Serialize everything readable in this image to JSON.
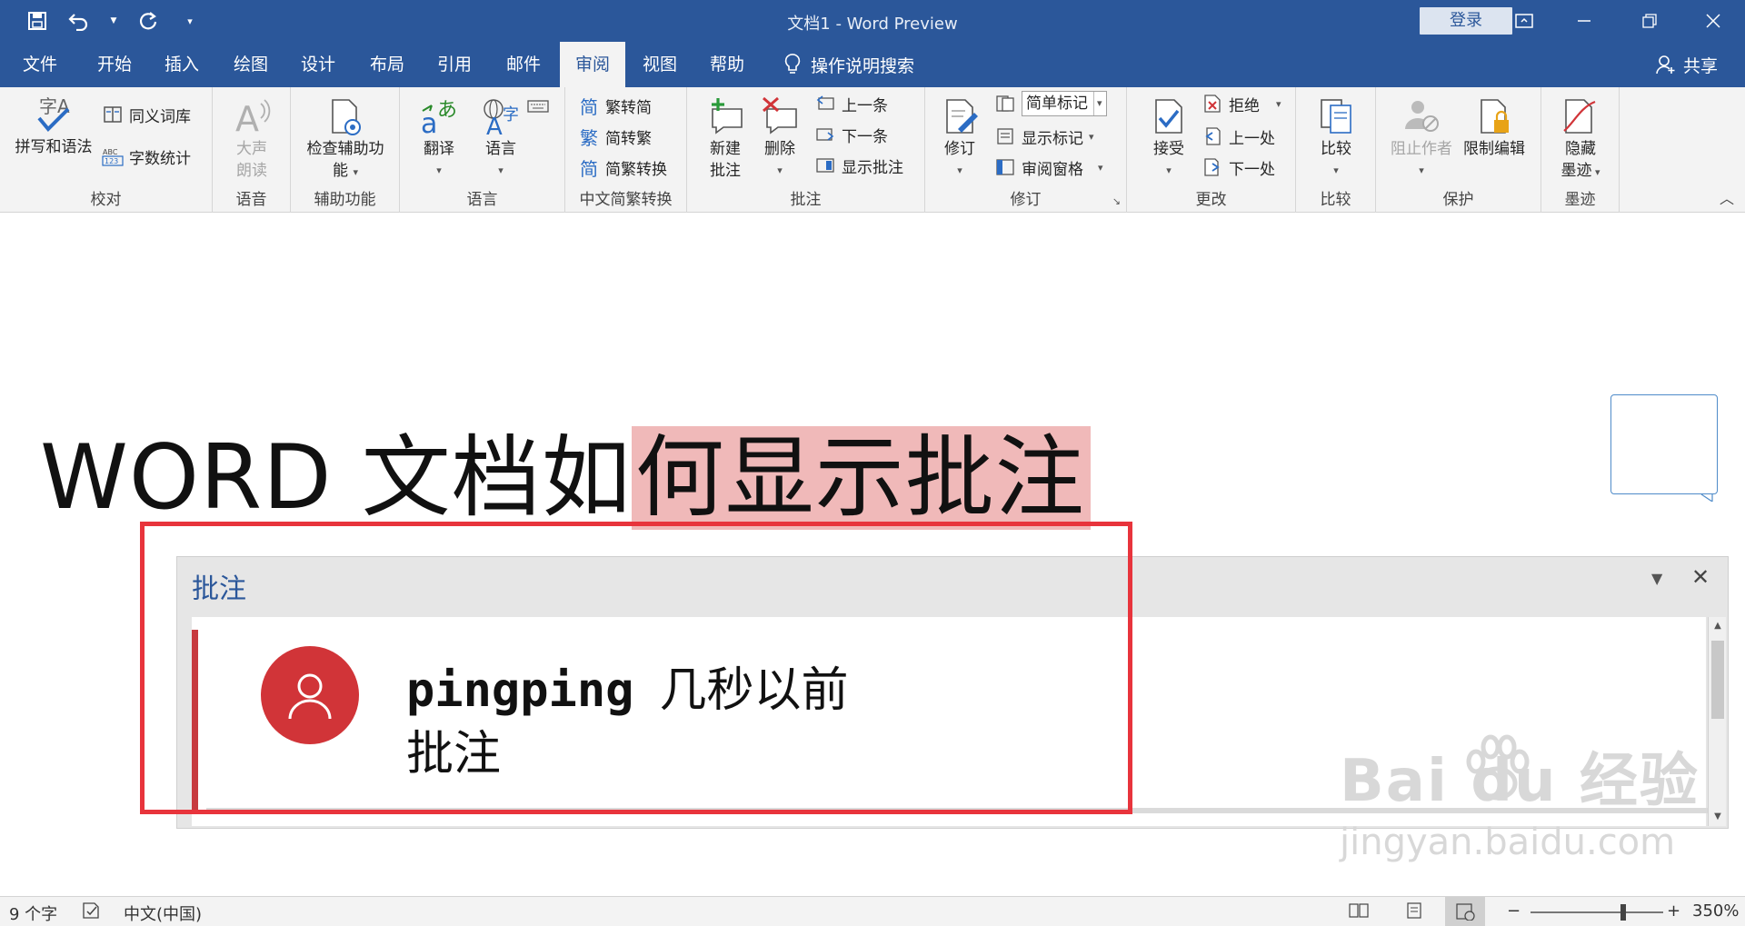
{
  "window": {
    "title": "文档1  -  Word Preview",
    "login_label": "登录"
  },
  "tabs": [
    {
      "label": "文件"
    },
    {
      "label": "开始"
    },
    {
      "label": "插入"
    },
    {
      "label": "绘图"
    },
    {
      "label": "设计"
    },
    {
      "label": "布局"
    },
    {
      "label": "引用"
    },
    {
      "label": "邮件"
    },
    {
      "label": "审阅",
      "active": true
    },
    {
      "label": "视图"
    },
    {
      "label": "帮助"
    }
  ],
  "tellme_label": "操作说明搜索",
  "share_label": "共享",
  "ribbon": {
    "proofing": {
      "label": "校对",
      "spelling": "拼写和语法",
      "thesaurus": "同义词库",
      "wordcount": "字数统计",
      "spell_icon_text": "字A",
      "wc_icon_text": "ABC 123"
    },
    "speech": {
      "label": "语音",
      "read_aloud": "大声朗读"
    },
    "accessibility": {
      "label": "辅助功能",
      "check": "检查辅助功能"
    },
    "language": {
      "label": "语言",
      "translate": "翻译",
      "language": "语言"
    },
    "chinese": {
      "label": "中文简繁转换",
      "to_simplified": "繁转简",
      "to_traditional": "简转繁",
      "convert": "简繁转换",
      "glyph_simplified": "简",
      "glyph_traditional": "繁",
      "glyph_convert": "简"
    },
    "comments": {
      "label": "批注",
      "new": "新建批注",
      "delete": "删除",
      "previous": "上一条",
      "next": "下一条",
      "show": "显示批注"
    },
    "tracking": {
      "label": "修订",
      "track": "修订",
      "markup_mode": "简单标记",
      "show_markup": "显示标记",
      "reviewing_pane": "审阅窗格"
    },
    "changes": {
      "label": "更改",
      "accept": "接受",
      "reject": "拒绝",
      "previous": "上一处",
      "next": "下一处"
    },
    "compare": {
      "label": "比较",
      "compare": "比较"
    },
    "protect": {
      "label": "保护",
      "block_authors": "阻止作者",
      "restrict": "限制编辑"
    },
    "ink": {
      "label": "墨迹",
      "hide_ink": "隐藏墨迹"
    }
  },
  "document": {
    "heading_plain_latin": "WORD ",
    "heading_plain_cjk": "文档如",
    "heading_highlighted": "何显示批注"
  },
  "comments_pane": {
    "title": "批注",
    "comment": {
      "author": "pingping",
      "timestamp": "几秒以前",
      "text": "批注"
    }
  },
  "watermark": {
    "main": "Bai du 经验",
    "sub": "jingyan.baidu.com"
  },
  "status": {
    "word_count": "9 个字",
    "language": "中文(中国)",
    "zoom": "350%",
    "zoom_minus": "−",
    "zoom_plus": "+",
    "zoom_level_fraction": 0.7
  },
  "colors": {
    "titlebar": "#2b579a",
    "highlight": "#f0b9b9",
    "avatar": "#d13438",
    "annotation_box": "#e8343c"
  }
}
